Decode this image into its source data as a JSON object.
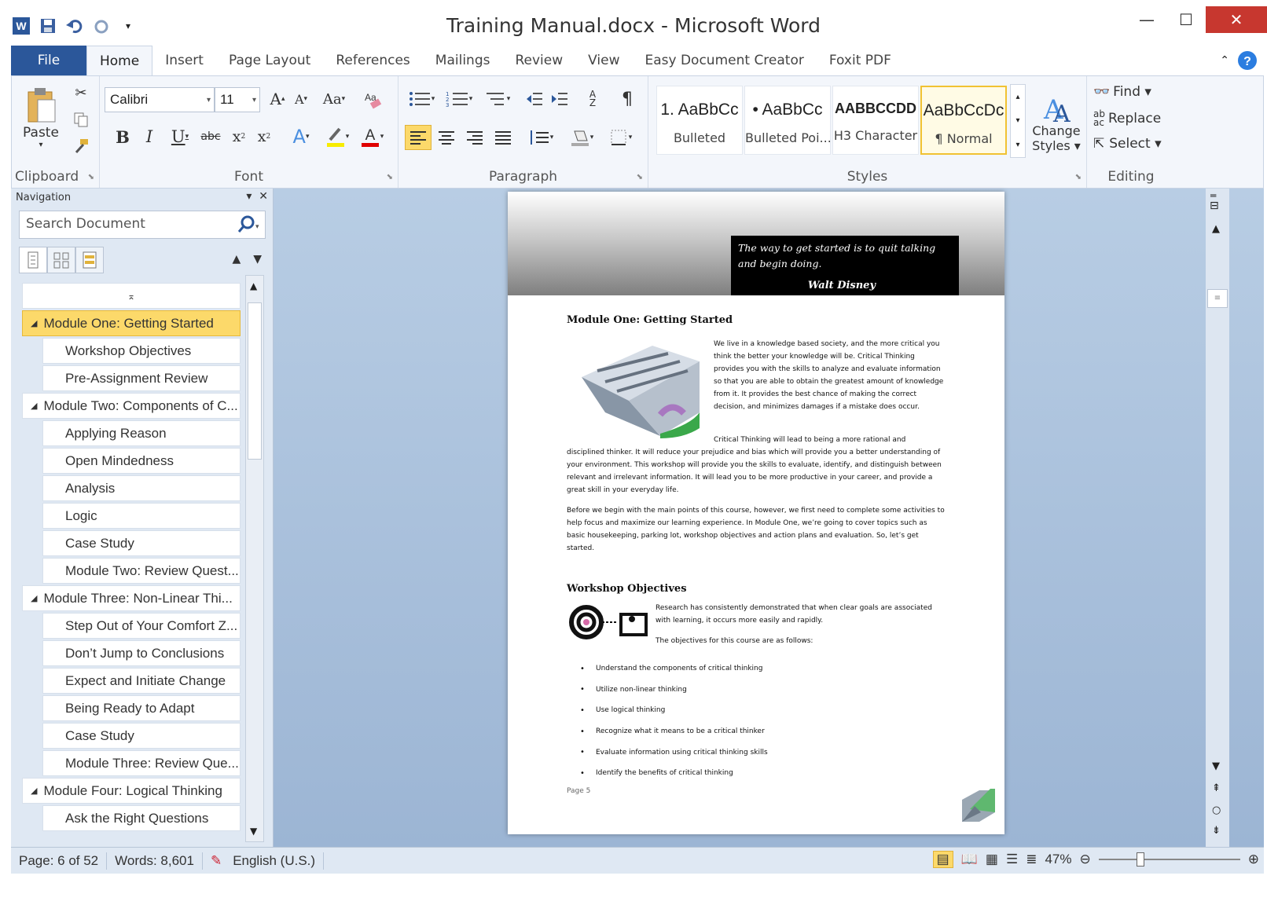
{
  "window": {
    "title": "Training Manual.docx - Microsoft Word",
    "minimize": "—",
    "maximize": "☐",
    "close": "✕"
  },
  "tabs": [
    "File",
    "Home",
    "Insert",
    "Page Layout",
    "References",
    "Mailings",
    "Review",
    "View",
    "Easy Document Creator",
    "Foxit PDF"
  ],
  "ribbon": {
    "clipboard": {
      "label": "Clipboard",
      "paste": "Paste"
    },
    "font": {
      "label": "Font",
      "name": "Calibri",
      "size": "11"
    },
    "paragraph": {
      "label": "Paragraph"
    },
    "styles": {
      "label": "Styles",
      "items": [
        {
          "preview": "1.  AaBbCc",
          "name": "Bulleted"
        },
        {
          "preview": "•  AaBbCc",
          "name": "Bulleted Poi..."
        },
        {
          "preview": "AABBCCDD",
          "name": "H3 Character"
        },
        {
          "preview": "AaBbCcDc",
          "name": "¶ Normal"
        }
      ],
      "change_styles": [
        "Change",
        "Styles ▾"
      ]
    },
    "editing": {
      "label": "Editing",
      "find": "Find ▾",
      "replace": "Replace",
      "select": "Select ▾"
    }
  },
  "navigation": {
    "title": "Navigation",
    "search_placeholder": "Search Document",
    "items": [
      {
        "label": "",
        "level": 0
      },
      {
        "label": "Module One: Getting Started",
        "level": 1,
        "active": true
      },
      {
        "label": "Workshop Objectives",
        "level": 2
      },
      {
        "label": "Pre-Assignment Review",
        "level": 2
      },
      {
        "label": "Module Two: Components of C...",
        "level": 1
      },
      {
        "label": "Applying Reason",
        "level": 2
      },
      {
        "label": "Open Mindedness",
        "level": 2
      },
      {
        "label": "Analysis",
        "level": 2
      },
      {
        "label": "Logic",
        "level": 2
      },
      {
        "label": "Case Study",
        "level": 2
      },
      {
        "label": "Module Two: Review Quest...",
        "level": 2
      },
      {
        "label": "Module Three: Non-Linear Thi...",
        "level": 1
      },
      {
        "label": "Step Out of Your Comfort Z...",
        "level": 2
      },
      {
        "label": "Don’t Jump to Conclusions",
        "level": 2
      },
      {
        "label": "Expect and Initiate Change",
        "level": 2
      },
      {
        "label": "Being Ready to Adapt",
        "level": 2
      },
      {
        "label": "Case Study",
        "level": 2
      },
      {
        "label": "Module Three: Review Que...",
        "level": 2
      },
      {
        "label": "Module Four: Logical Thinking",
        "level": 1
      },
      {
        "label": "Ask the Right Questions",
        "level": 2
      }
    ]
  },
  "document": {
    "quote": "The way to get started is to quit talking and begin doing.",
    "quote_author": "Walt Disney",
    "heading1": "Module One: Getting Started",
    "para1": "We live in a knowledge based society, and the more critical you think the better your knowledge will be. Critical Thinking provides you with the skills to analyze and evaluate information so that you are able to obtain the greatest amount of knowledge from it. It provides the best chance of making the correct decision, and minimizes damages if a mistake does occur.",
    "para2_indent": "Critical Thinking will lead to being a more rational and",
    "para2_rest": "disciplined thinker. It will reduce your prejudice and bias which will provide you a better understanding of your environment. This workshop will provide you the skills to evaluate, identify, and distinguish between relevant and irrelevant information. It will lead you to be more productive in your career, and provide a great skill in your everyday life.",
    "para3": "Before we begin with the main points of this course, however, we first need to complete some activities to help focus and maximize our learning experience. In Module One, we’re going to cover topics such as basic housekeeping, parking lot, workshop objectives and action plans and evaluation. So, let’s get started.",
    "heading2": "Workshop Objectives",
    "para4": "Research has consistently demonstrated that when clear goals are associated with learning, it occurs more easily and rapidly.",
    "para5": "The objectives for this course are as follows:",
    "bullets": [
      "Understand the components of critical thinking",
      "Utilize non-linear thinking",
      "Use logical thinking",
      "Recognize what it means to be a critical thinker",
      "Evaluate information using critical thinking skills",
      "Identify the benefits of critical thinking"
    ],
    "footer": "Page 5"
  },
  "status": {
    "page": "Page: 6 of 52",
    "words": "Words: 8,601",
    "language": "English (U.S.)",
    "zoom": "47%"
  }
}
